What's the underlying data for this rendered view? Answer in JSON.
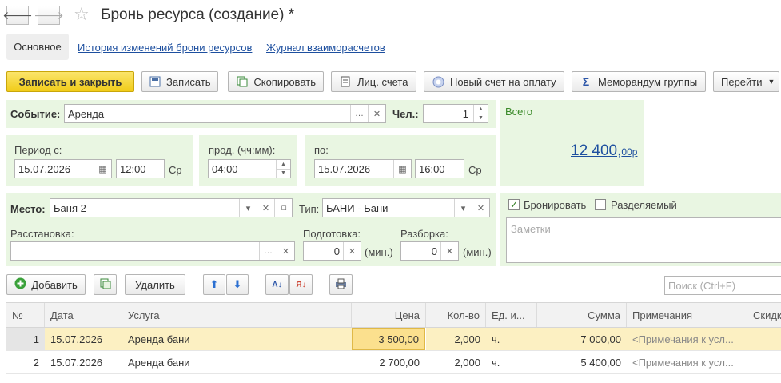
{
  "window": {
    "title": "Бронь ресурса (создание) *"
  },
  "tabs": {
    "main": "Основное",
    "history": "История изменений брони ресурсов",
    "journal": "Журнал взаиморасчетов"
  },
  "toolbar": {
    "save_close": "Записать и закрыть",
    "save": "Записать",
    "copy": "Скопировать",
    "accounts": "Лиц. счета",
    "new_invoice": "Новый счет на оплату",
    "memo": "Меморандум группы",
    "goto": "Перейти"
  },
  "form": {
    "event_label": "Событие:",
    "event_value": "Аренда",
    "persons_label": "Чел.:",
    "persons_value": "1",
    "period_from_label": "Период с:",
    "date_from": "15.07.2026",
    "time_from": "12:00",
    "day_from": "Ср",
    "duration_label": "прод. (чч:мм):",
    "duration": "04:00",
    "period_to_label": "по:",
    "date_to": "15.07.2026",
    "time_to": "16:00",
    "day_to": "Ср",
    "place_label": "Место:",
    "place_value": "Баня 2",
    "type_label": "Тип:",
    "type_value": "БАНИ - Бани",
    "arrangement_label": "Расстановка:",
    "arrangement_value": "",
    "prep_label": "Подготовка:",
    "prep_value": "0",
    "prep_unit": "(мин.)",
    "teardown_label": "Разборка:",
    "teardown_value": "0",
    "teardown_unit": "(мин.)"
  },
  "summary": {
    "total_label": "Всего",
    "total_main": "12 400,",
    "total_cents": "00р"
  },
  "options": {
    "book_label": "Бронировать",
    "book_checked": true,
    "shared_label": "Разделяемый",
    "shared_checked": false,
    "notes_placeholder": "Заметки"
  },
  "table_toolbar": {
    "add": "Добавить",
    "delete": "Удалить",
    "search_placeholder": "Поиск (Ctrl+F)"
  },
  "table": {
    "columns": [
      "№",
      "Дата",
      "Услуга",
      "Цена",
      "Кол-во",
      "Ед. и...",
      "Сумма",
      "Примечания",
      "Скидка"
    ],
    "rows": [
      {
        "n": "1",
        "date": "15.07.2026",
        "service": "Аренда бани",
        "price": "3 500,00",
        "qty": "2,000",
        "unit": "ч.",
        "sum": "7 000,00",
        "note": "<Примечания к усл..."
      },
      {
        "n": "2",
        "date": "15.07.2026",
        "service": "Аренда бани",
        "price": "2 700,00",
        "qty": "2,000",
        "unit": "ч.",
        "sum": "5 400,00",
        "note": "<Примечания к усл..."
      }
    ]
  },
  "icons": [
    "arrow-left-icon",
    "arrow-right-icon",
    "star-icon",
    "save-icon",
    "copy-icon",
    "ledger-icon",
    "invoice-icon",
    "sigma-icon",
    "plus-icon",
    "calendar-icon",
    "sort-icon",
    "print-icon"
  ],
  "colors": {
    "primary_button": "#f1cc19",
    "panel_green": "#e9f6e2",
    "link": "#1d4f9f",
    "selected_row": "#fcf0c2"
  }
}
